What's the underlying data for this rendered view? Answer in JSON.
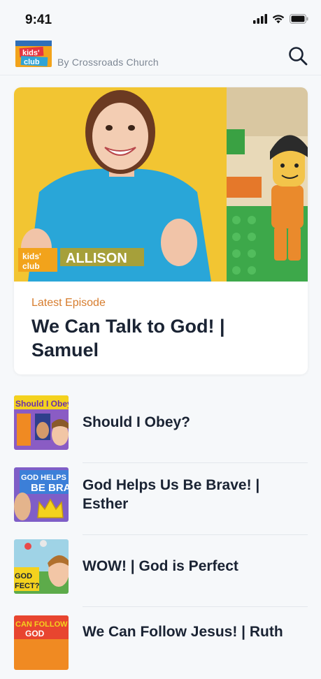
{
  "status": {
    "time": "9:41"
  },
  "header": {
    "logo_text": "kids' club",
    "byline": "By Crossroads Church",
    "search_icon": "search-icon"
  },
  "hero": {
    "host_tag": "ALLISON",
    "kicker": "Latest Episode",
    "title": "We Can Talk to God! | Samuel"
  },
  "episodes": [
    {
      "title": "Should I Obey?",
      "thumb_text": "Should I Obey?"
    },
    {
      "title": "God Helps Us Be Brave! | Esther",
      "thumb_text": "GOD HELPS BE BRAVE"
    },
    {
      "title": "WOW! | God is Perfect",
      "thumb_text": "GOD PERFECT?"
    },
    {
      "title": "We Can Follow Jesus! | Ruth",
      "thumb_text": "CAN FOLLOW GOD"
    }
  ],
  "colors": {
    "accent": "#d77d2e",
    "title": "#1a2333",
    "background": "#f6f8fa"
  }
}
